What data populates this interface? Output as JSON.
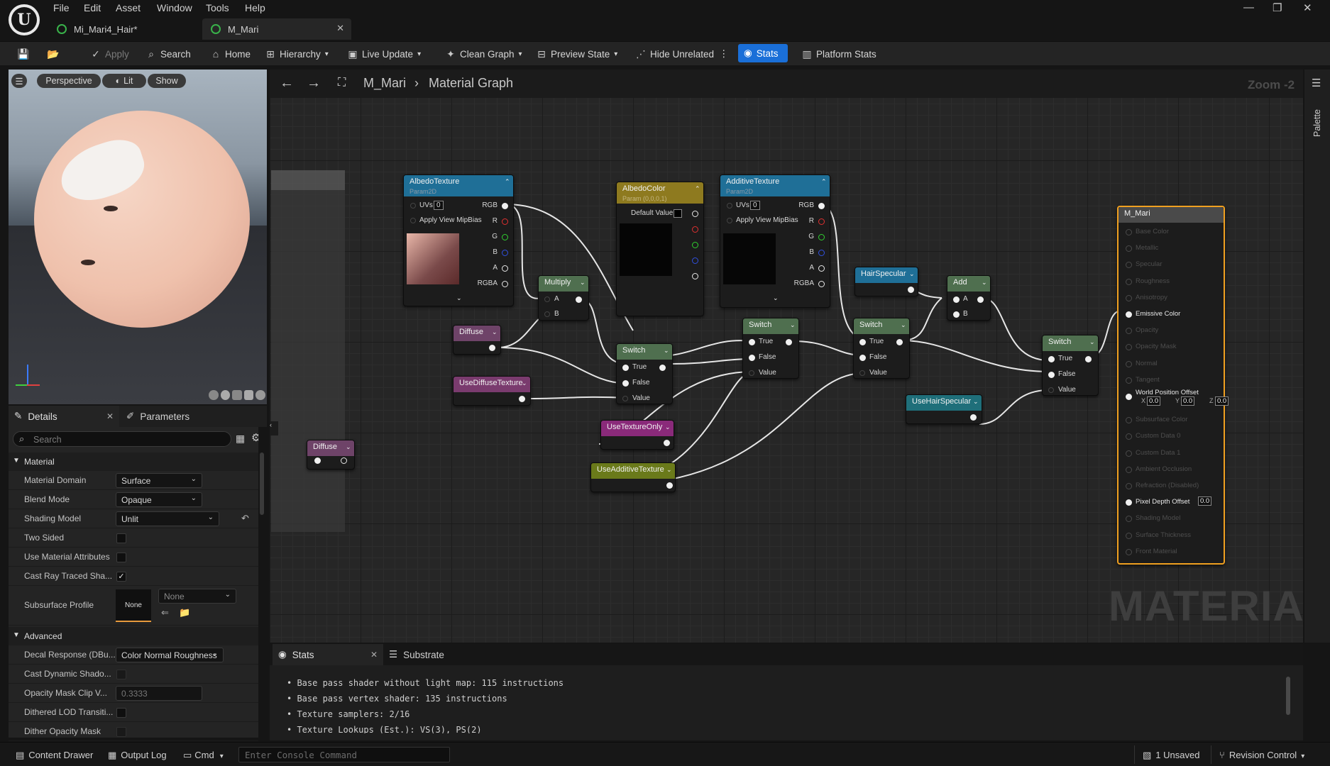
{
  "menu": [
    "File",
    "Edit",
    "Asset",
    "Window",
    "Tools",
    "Help"
  ],
  "tabs": [
    {
      "label": "Mi_Mari4_Hair*"
    },
    {
      "label": "M_Mari"
    }
  ],
  "toolbar": {
    "apply": "Apply",
    "search": "Search",
    "home": "Home",
    "hierarchy": "Hierarchy",
    "live_update": "Live Update",
    "clean_graph": "Clean Graph",
    "preview_state": "Preview State",
    "hide_unrelated": "Hide Unrelated",
    "stats": "Stats",
    "platform_stats": "Platform Stats"
  },
  "viewport": {
    "perspective": "Perspective",
    "lit": "Lit",
    "show": "Show"
  },
  "details": {
    "tab_details": "Details",
    "tab_parameters": "Parameters",
    "search_placeholder": "Search",
    "section_material": "Material",
    "material_domain_label": "Material Domain",
    "material_domain_value": "Surface",
    "blend_mode_label": "Blend Mode",
    "blend_mode_value": "Opaque",
    "shading_model_label": "Shading Model",
    "shading_model_value": "Unlit",
    "two_sided_label": "Two Sided",
    "use_material_attributes_label": "Use Material Attributes",
    "cast_ray_traced_label": "Cast Ray Traced Sha...",
    "subsurface_profile_label": "Subsurface Profile",
    "subsurface_thumb": "None",
    "subsurface_value": "None",
    "section_advanced": "Advanced",
    "decal_response_label": "Decal Response (DBu...",
    "decal_response_value": "Color Normal Roughness",
    "cast_dynamic_label": "Cast Dynamic Shado...",
    "opacity_clip_label": "Opacity Mask Clip V...",
    "opacity_clip_value": "0.3333",
    "dithered_lod_label": "Dithered LOD Transiti...",
    "dither_opacity_label": "Dither Opacity Mask"
  },
  "graph": {
    "breadcrumb_asset": "M_Mari",
    "breadcrumb_graph": "Material Graph",
    "zoom": "Zoom -2",
    "palette": "Palette",
    "watermark": "MATERIAL"
  },
  "nodes": {
    "albedo_texture": {
      "title": "AlbedoTexture",
      "sub": "Param2D",
      "uvs": "UVs",
      "uv_val": "0",
      "mip": "Apply View MipBias",
      "pins": [
        "RGB",
        "R",
        "G",
        "B",
        "A",
        "RGBA"
      ]
    },
    "additive_texture": {
      "title": "AdditiveTexture",
      "sub": "Param2D",
      "uvs": "UVs",
      "uv_val": "0",
      "mip": "Apply View MipBias",
      "pins": [
        "RGB",
        "R",
        "G",
        "B",
        "A",
        "RGBA"
      ]
    },
    "albedo_color": {
      "title": "AlbedoColor",
      "sub": "Param (0,0,0,1)",
      "default": "Default Value"
    },
    "multiply": {
      "title": "Multiply",
      "a": "A",
      "b": "B"
    },
    "diffuse_1": {
      "title": "Diffuse"
    },
    "diffuse_2": {
      "title": "Diffuse"
    },
    "use_diffuse_texture": {
      "title": "UseDiffuseTexture"
    },
    "switch_1": {
      "title": "Switch",
      "true": "True",
      "false": "False",
      "value": "Value"
    },
    "switch_2": {
      "title": "Switch",
      "true": "True",
      "false": "False",
      "value": "Value"
    },
    "switch_3": {
      "title": "Switch",
      "true": "True",
      "false": "False",
      "value": "Value"
    },
    "switch_4": {
      "title": "Switch",
      "true": "True",
      "false": "False",
      "value": "Value"
    },
    "use_texture_only": {
      "title": "UseTextureOnly"
    },
    "use_additive_texture": {
      "title": "UseAdditiveTexture"
    },
    "hair_specular": {
      "title": "HairSpecular"
    },
    "add": {
      "title": "Add",
      "a": "A",
      "b": "B"
    },
    "use_hair_specular": {
      "title": "UseHairSpecular"
    },
    "result": {
      "title": "M_Mari",
      "pins": [
        "Base Color",
        "Metallic",
        "Specular",
        "Roughness",
        "Anisotropy",
        "Emissive Color",
        "Opacity",
        "Opacity Mask",
        "Normal",
        "Tangent"
      ],
      "wpo": "World Position Offset",
      "wpo_x": "X",
      "wpo_x_val": "0.0",
      "wpo_y": "Y",
      "wpo_y_val": "0.0",
      "wpo_z": "Z",
      "wpo_z_val": "0.0",
      "pins2": [
        "Subsurface Color",
        "Custom Data 0",
        "Custom Data 1",
        "Ambient Occlusion",
        "Refraction (Disabled)"
      ],
      "pdo": "Pixel Depth Offset",
      "pdo_val": "0.0",
      "pins3": [
        "Shading Model",
        "Surface Thickness",
        "Front Material"
      ]
    }
  },
  "stats_panel": {
    "tab_stats": "Stats",
    "tab_substrate": "Substrate",
    "lines": [
      "Base pass shader without light map: 115 instructions",
      "Base pass vertex shader: 135 instructions",
      "Texture samplers: 2/16",
      "Texture Lookups (Est.): VS(3), PS(2)"
    ]
  },
  "statusbar": {
    "content_drawer": "Content Drawer",
    "output_log": "Output Log",
    "cmd": "Cmd",
    "console_placeholder": "Enter Console Command",
    "unsaved": "1 Unsaved",
    "revision_control": "Revision Control"
  },
  "colors": {
    "accent_blue": "#1a6fd8",
    "texture_header": "#1f6f97",
    "parameter_header": "#8e7a1f",
    "math_header": "#4f6f4f",
    "switch_param_header": "#7a3b6e",
    "selected_border": "#f0a020"
  }
}
